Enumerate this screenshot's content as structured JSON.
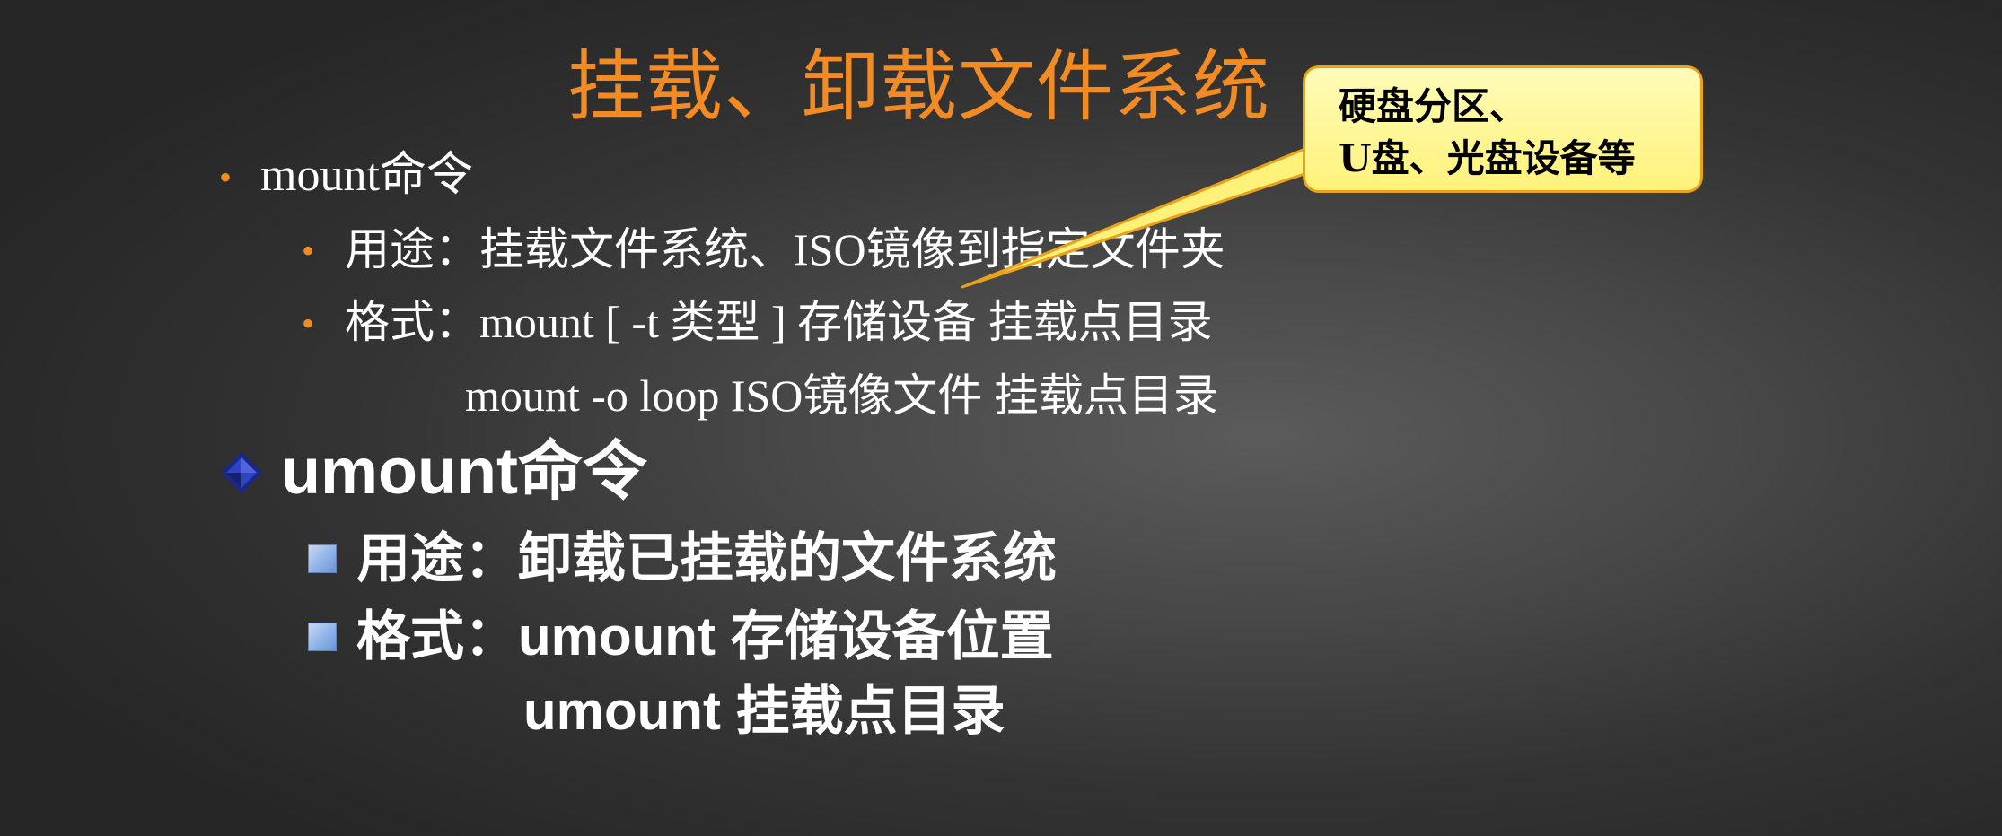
{
  "title": "挂载、卸载文件系统",
  "mount": {
    "heading": "mount命令",
    "usage": "用途：挂载文件系统、ISO镜像到指定文件夹",
    "format_line1": "格式：mount  [ -t 类型 ]  存储设备  挂载点目录",
    "format_line2": "mount  -o loop  ISO镜像文件  挂载点目录"
  },
  "umount": {
    "heading": "umount命令",
    "usage": "用途：卸载已挂载的文件系统",
    "format_line1": "格式：umount  存储设备位置",
    "format_line2": "umount  挂载点目录"
  },
  "callout": {
    "line1": "硬盘分区、",
    "line2": "U盘、光盘设备等"
  },
  "colors": {
    "title": "#f38b24",
    "bullet": "#f38b24",
    "callout_fill": "#fff27a",
    "callout_border": "#e9a21a",
    "diamond": "#1f2f99",
    "square_bullet": "#8fb2e8"
  },
  "icons": {
    "level1_mount_bullet": "orange-dot-icon",
    "level2_mount_bullet": "orange-dot-icon",
    "umount_bullet": "blue-diamond-icon",
    "umount_sub_bullet": "blue-square-icon"
  }
}
